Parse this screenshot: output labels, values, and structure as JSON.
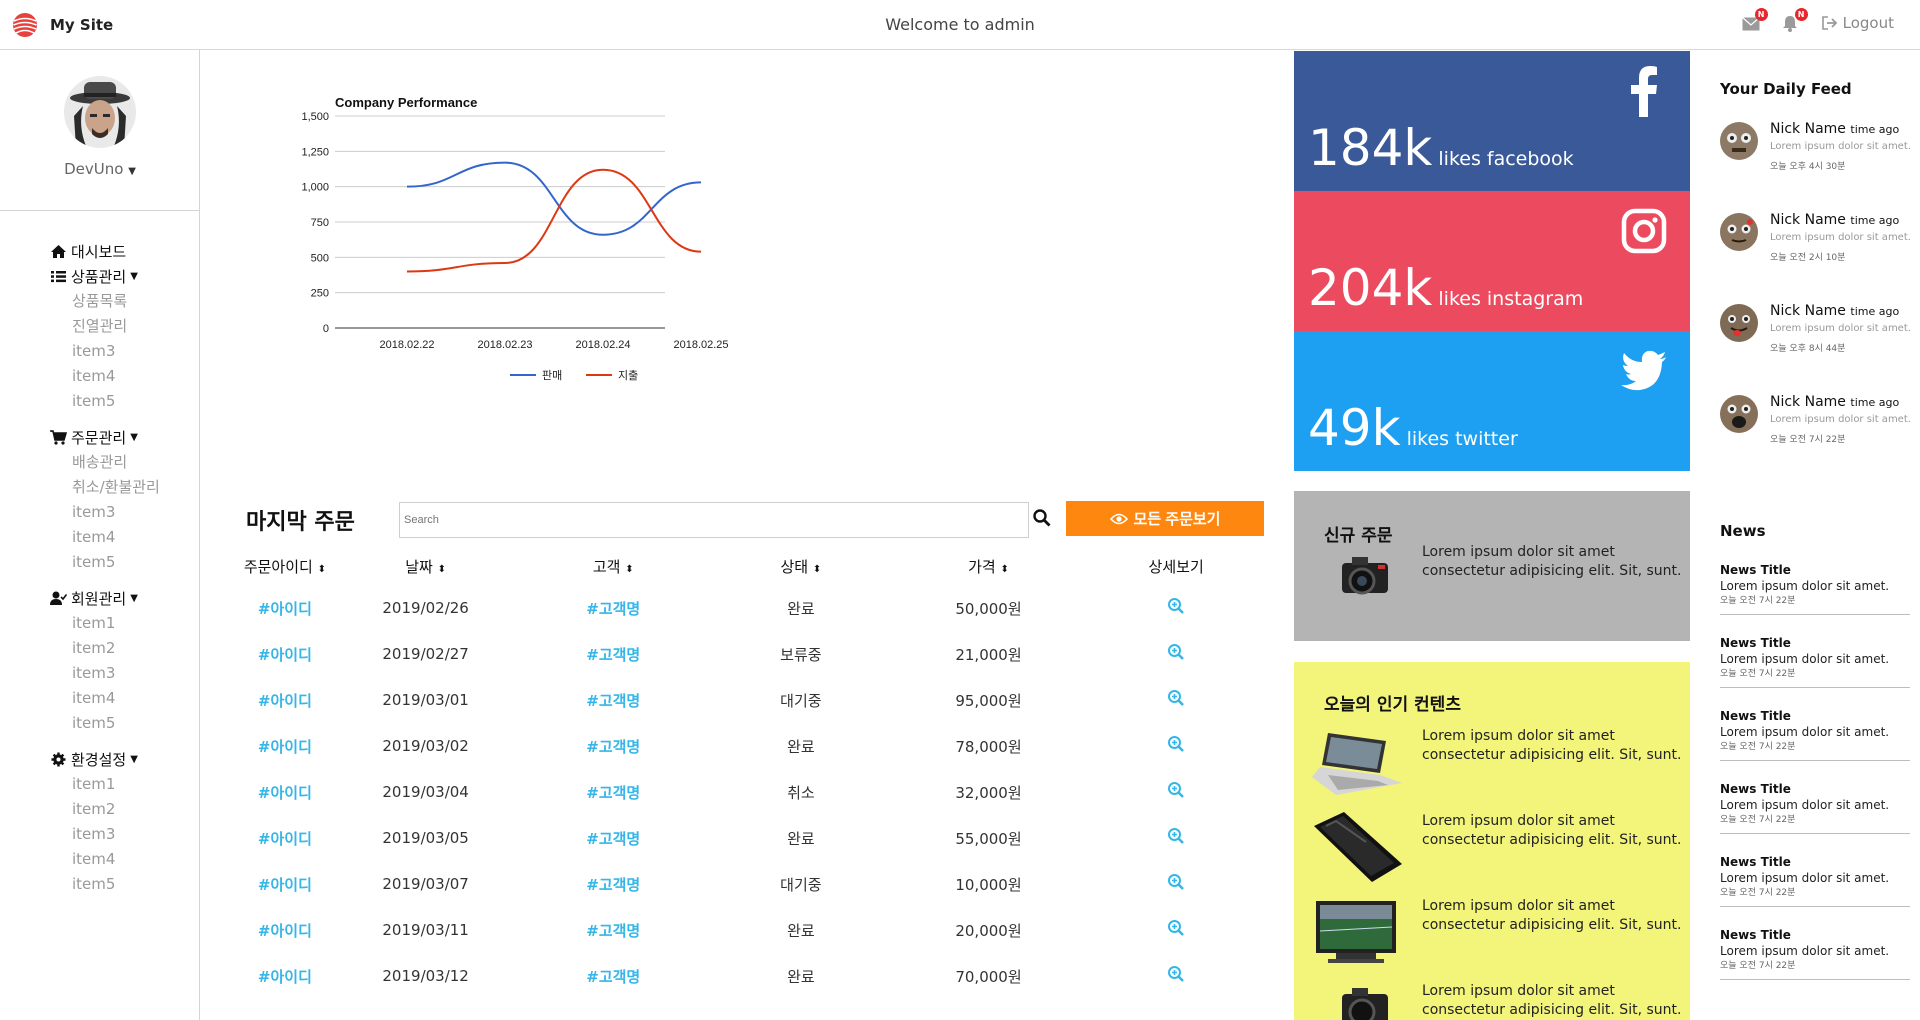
{
  "header": {
    "site_name": "My Site",
    "welcome": "Welcome to admin",
    "notice_badge": "N",
    "alert_badge": "N",
    "logout": "Logout"
  },
  "sidebar": {
    "username": "DevUno",
    "menus": [
      {
        "label": "대시보드",
        "icon": "home-icon",
        "items": []
      },
      {
        "label": "상품관리",
        "icon": "list-icon",
        "items": [
          "상품목록",
          "진열관리",
          "item3",
          "item4",
          "item5"
        ]
      },
      {
        "label": "주문관리",
        "icon": "cart-icon",
        "items": [
          "배송관리",
          "취소/환불관리",
          "item3",
          "item4",
          "item5"
        ]
      },
      {
        "label": "회원관리",
        "icon": "user-check-icon",
        "items": [
          "item1",
          "item2",
          "item3",
          "item4",
          "item5"
        ]
      },
      {
        "label": "환경설정",
        "icon": "gear-icon",
        "items": [
          "item1",
          "item2",
          "item3",
          "item4",
          "item5"
        ]
      }
    ]
  },
  "chart_data": {
    "type": "line",
    "title": "Company Performance",
    "categories": [
      "2018.02.22",
      "2018.02.23",
      "2018.02.24",
      "2018.02.25"
    ],
    "yticks": [
      "0",
      "250",
      "500",
      "750",
      "1,000",
      "1,250",
      "1,500"
    ],
    "ylim": [
      0,
      1500
    ],
    "series": [
      {
        "name": "판매",
        "color": "#3366cc",
        "values": [
          1000,
          1170,
          660,
          1030
        ]
      },
      {
        "name": "지출",
        "color": "#dc3912",
        "values": [
          400,
          460,
          1120,
          540
        ]
      }
    ],
    "legend": "bottom",
    "grid": true
  },
  "orders": {
    "title": "마지막 주문",
    "search_placeholder": "Search",
    "view_all": "모든 주문보기",
    "columns": [
      "주문아이디",
      "날짜",
      "고객",
      "상태",
      "가격",
      "상세보기"
    ],
    "rows": [
      {
        "id": "#아이디",
        "date": "2019/02/26",
        "customer": "#고객명",
        "status": "완료",
        "price": "50,000원"
      },
      {
        "id": "#아이디",
        "date": "2019/02/27",
        "customer": "#고객명",
        "status": "보류중",
        "price": "21,000원"
      },
      {
        "id": "#아이디",
        "date": "2019/03/01",
        "customer": "#고객명",
        "status": "대기중",
        "price": "95,000원"
      },
      {
        "id": "#아이디",
        "date": "2019/03/02",
        "customer": "#고객명",
        "status": "완료",
        "price": "78,000원"
      },
      {
        "id": "#아이디",
        "date": "2019/03/04",
        "customer": "#고객명",
        "status": "취소",
        "price": "32,000원"
      },
      {
        "id": "#아이디",
        "date": "2019/03/05",
        "customer": "#고객명",
        "status": "완료",
        "price": "55,000원"
      },
      {
        "id": "#아이디",
        "date": "2019/03/07",
        "customer": "#고객명",
        "status": "대기중",
        "price": "10,000원"
      },
      {
        "id": "#아이디",
        "date": "2019/03/11",
        "customer": "#고객명",
        "status": "완료",
        "price": "20,000원"
      },
      {
        "id": "#아이디",
        "date": "2019/03/12",
        "customer": "#고객명",
        "status": "완료",
        "price": "70,000원"
      }
    ]
  },
  "social": {
    "facebook": {
      "count": "184k",
      "label": "likes facebook",
      "color": "#3a5999"
    },
    "instagram": {
      "count": "204k",
      "label": "likes instagram",
      "color": "#ec4b5f"
    },
    "twitter": {
      "count": "49k",
      "label": "likes twitter",
      "color": "#1ea0f2"
    }
  },
  "new_orders": {
    "title": "신규 주문",
    "line1": "Lorem ipsum dolor sit amet",
    "line2": "consectetur adipisicing elit. Sit, sunt."
  },
  "popular": {
    "title": "오늘의 인기 컨텐츠",
    "items": [
      {
        "icon": "laptop-icon",
        "line1": "Lorem ipsum dolor sit amet",
        "line2": "consectetur adipisicing elit. Sit, sunt."
      },
      {
        "icon": "phone-icon",
        "line1": "Lorem ipsum dolor sit amet",
        "line2": "consectetur adipisicing elit. Sit, sunt."
      },
      {
        "icon": "tv-icon",
        "line1": "Lorem ipsum dolor sit amet",
        "line2": "consectetur adipisicing elit. Sit, sunt."
      },
      {
        "icon": "camera-icon",
        "line1": "Lorem ipsum dolor sit amet",
        "line2": "consectetur adipisicing elit. Sit, sunt."
      }
    ]
  },
  "feed": {
    "title": "Your Daily Feed",
    "items": [
      {
        "name": "Nick Name",
        "ago": "time ago",
        "text": "Lorem ipsum dolor sit amet.",
        "time": "오늘 오후 4시 30분"
      },
      {
        "name": "Nick Name",
        "ago": "time ago",
        "text": "Lorem ipsum dolor sit amet.",
        "time": "오늘 오전 2시 10분"
      },
      {
        "name": "Nick Name",
        "ago": "time ago",
        "text": "Lorem ipsum dolor sit amet.",
        "time": "오늘 오후 8시 44분"
      },
      {
        "name": "Nick Name",
        "ago": "time ago",
        "text": "Lorem ipsum dolor sit amet.",
        "time": "오늘 오전 7시 22분"
      }
    ]
  },
  "news": {
    "title": "News",
    "items": [
      {
        "title": "News Title",
        "text": "Lorem ipsum dolor sit amet.",
        "time": "오늘 오전 7시 22분"
      },
      {
        "title": "News Title",
        "text": "Lorem ipsum dolor sit amet.",
        "time": "오늘 오전 7시 22분"
      },
      {
        "title": "News Title",
        "text": "Lorem ipsum dolor sit amet.",
        "time": "오늘 오전 7시 22분"
      },
      {
        "title": "News Title",
        "text": "Lorem ipsum dolor sit amet.",
        "time": "오늘 오전 7시 22분"
      },
      {
        "title": "News Title",
        "text": "Lorem ipsum dolor sit amet.",
        "time": "오늘 오전 7시 22분"
      },
      {
        "title": "News Title",
        "text": "Lorem ipsum dolor sit amet.",
        "time": "오늘 오전 7시 22분"
      }
    ]
  }
}
